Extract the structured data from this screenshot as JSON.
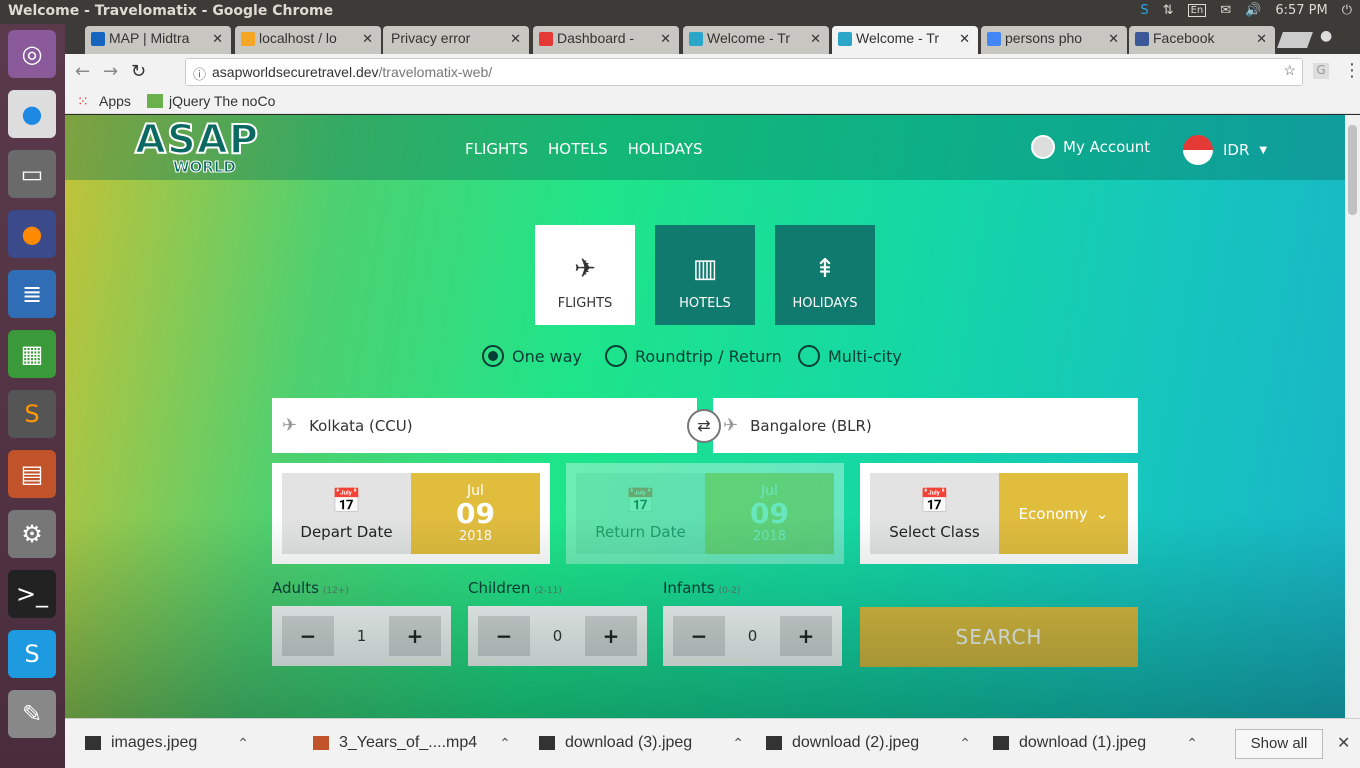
{
  "os": {
    "window_title": "Welcome - Travelomatix - Google Chrome",
    "keyboard": "En",
    "clock": "6:57 PM"
  },
  "tabs": [
    {
      "label": "MAP | Midtra",
      "active": false
    },
    {
      "label": "localhost / lo",
      "active": false
    },
    {
      "label": "Privacy error",
      "active": false
    },
    {
      "label": "Dashboard -",
      "active": false
    },
    {
      "label": "Welcome - Tr",
      "active": false
    },
    {
      "label": "Welcome - Tr",
      "active": true
    },
    {
      "label": "persons pho",
      "active": false
    },
    {
      "label": "Facebook",
      "active": false
    }
  ],
  "omnibox": {
    "host": "asapworldsecuretravel.dev",
    "path": "/travelomatix-web/"
  },
  "bookmarks": {
    "apps": "Apps",
    "item1": "jQuery The noCo"
  },
  "site": {
    "logo_top": "ASAP",
    "logo_bottom": "WORLD",
    "nav": [
      "FLIGHTS",
      "HOTELS",
      "HOLIDAYS"
    ],
    "account": "My Account",
    "currency": "IDR"
  },
  "services": [
    {
      "label": "FLIGHTS",
      "icon": "plane-icon",
      "selected": true
    },
    {
      "label": "HOTELS",
      "icon": "building-icon",
      "selected": false
    },
    {
      "label": "HOLIDAYS",
      "icon": "tree-icon",
      "selected": false
    }
  ],
  "trip_types": [
    {
      "label": "One way",
      "selected": true
    },
    {
      "label": "Roundtrip / Return",
      "selected": false
    },
    {
      "label": "Multi-city",
      "selected": false
    }
  ],
  "search": {
    "from": "Kolkata (CCU)",
    "to": "Bangalore (BLR)",
    "depart": {
      "label": "Depart Date",
      "month": "Jul",
      "day": "09",
      "year": "2018"
    },
    "return": {
      "label": "Return Date",
      "month": "Jul",
      "day": "09",
      "year": "2018"
    },
    "class": {
      "label": "Select Class",
      "value": "Economy"
    },
    "adults": {
      "label": "Adults",
      "range": "(12+)",
      "value": "1"
    },
    "children": {
      "label": "Children",
      "range": "(2-11)",
      "value": "0"
    },
    "infants": {
      "label": "Infants",
      "range": "(0-2)",
      "value": "0"
    },
    "minus": "−",
    "plus": "+",
    "button": "SEARCH"
  },
  "downloads": [
    {
      "name": "images.jpeg"
    },
    {
      "name": "3_Years_of_....mp4"
    },
    {
      "name": "download (3).jpeg"
    },
    {
      "name": "download (2).jpeg"
    },
    {
      "name": "download (1).jpeg"
    }
  ],
  "downloads_show_all": "Show all"
}
